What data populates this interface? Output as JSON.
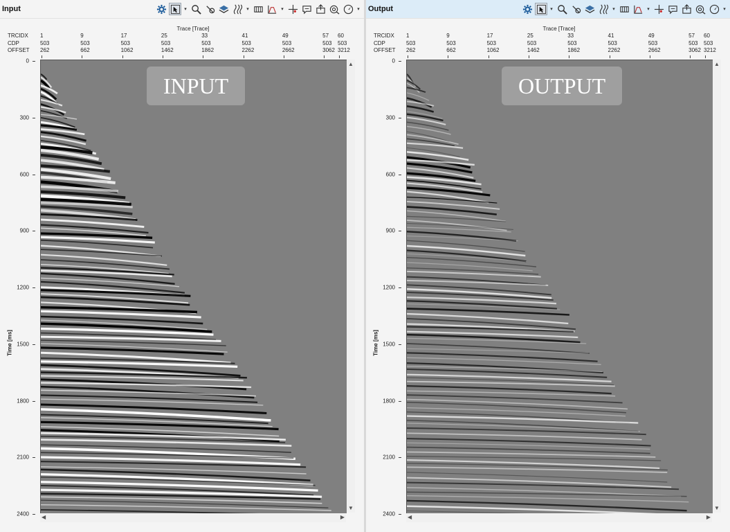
{
  "panels": [
    {
      "title": "Input",
      "overlay_label": "INPUT",
      "trace_axis_title": "Trace [Trace]",
      "header_rows": [
        "TRCIDX",
        "CDP",
        "OFFSET"
      ],
      "trace_ticks": [
        {
          "trcidx": "1",
          "cdp": "503",
          "offset": "262"
        },
        {
          "trcidx": "9",
          "cdp": "503",
          "offset": "662"
        },
        {
          "trcidx": "17",
          "cdp": "503",
          "offset": "1062"
        },
        {
          "trcidx": "25",
          "cdp": "503",
          "offset": "1462"
        },
        {
          "trcidx": "33",
          "cdp": "503",
          "offset": "1862"
        },
        {
          "trcidx": "41",
          "cdp": "503",
          "offset": "2262"
        },
        {
          "trcidx": "49",
          "cdp": "503",
          "offset": "2662"
        },
        {
          "trcidx": "57",
          "cdp": "503",
          "offset": "3062"
        },
        {
          "trcidx": "60",
          "cdp": "503",
          "offset": "3212"
        }
      ],
      "time_axis_title": "Time [ms]",
      "time_ticks": [
        "0",
        "300",
        "600",
        "900",
        "1200",
        "1500",
        "1800",
        "2100",
        "2400"
      ],
      "time_range": [
        0,
        2400
      ]
    },
    {
      "title": "Output",
      "overlay_label": "OUTPUT",
      "trace_axis_title": "Trace [Trace]",
      "header_rows": [
        "TRCIDX",
        "CDP",
        "OFFSET"
      ],
      "trace_ticks": [
        {
          "trcidx": "1",
          "cdp": "503",
          "offset": "262"
        },
        {
          "trcidx": "9",
          "cdp": "503",
          "offset": "662"
        },
        {
          "trcidx": "17",
          "cdp": "503",
          "offset": "1062"
        },
        {
          "trcidx": "25",
          "cdp": "503",
          "offset": "1462"
        },
        {
          "trcidx": "33",
          "cdp": "503",
          "offset": "1862"
        },
        {
          "trcidx": "41",
          "cdp": "503",
          "offset": "2262"
        },
        {
          "trcidx": "49",
          "cdp": "503",
          "offset": "2662"
        },
        {
          "trcidx": "57",
          "cdp": "503",
          "offset": "3062"
        },
        {
          "trcidx": "60",
          "cdp": "503",
          "offset": "3212"
        }
      ],
      "time_axis_title": "Time [ms]",
      "time_ticks": [
        "0",
        "300",
        "600",
        "900",
        "1200",
        "1500",
        "1800",
        "2100",
        "2400"
      ],
      "time_range": [
        0,
        2400
      ]
    }
  ],
  "toolbar_icons": [
    "settings-icon",
    "select-mode-icon",
    "zoom-icon",
    "pick-icon",
    "layers-icon",
    "wiggle-display-icon",
    "header-display-icon",
    "amplitude-spectrum-icon",
    "crosshair-icon",
    "annotation-icon",
    "export-image-icon",
    "view-all-icon",
    "navigation-icon"
  ],
  "colors": {
    "background_gray": "#808080",
    "peak": "#000000",
    "trough": "#ffffff",
    "output_titlebar": "#dcecf8"
  }
}
